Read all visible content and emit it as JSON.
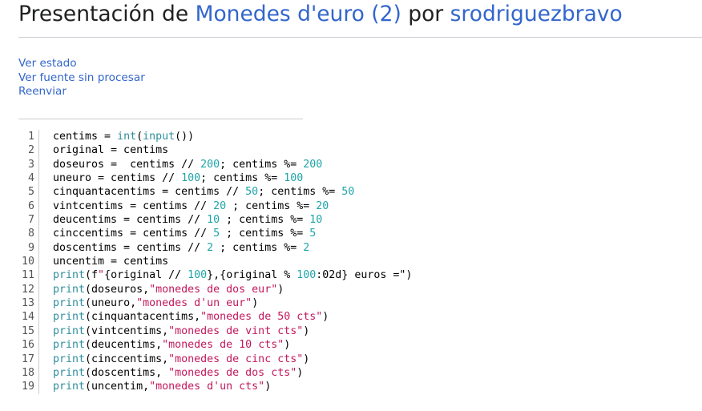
{
  "header": {
    "prefix": "Presentación de ",
    "problem_link": "Monedes d'euro (2)",
    "middle": " por ",
    "user_link": "srodriguezbravo"
  },
  "actions": [
    {
      "label": "Ver estado"
    },
    {
      "label": "Ver fuente sin procesar"
    },
    {
      "label": "Reenviar"
    }
  ],
  "code_lines": [
    [
      {
        "t": "centims = ",
        "c": "sym"
      },
      {
        "t": "int",
        "c": "kw"
      },
      {
        "t": "(",
        "c": "sym"
      },
      {
        "t": "input",
        "c": "kw"
      },
      {
        "t": "())",
        "c": "sym"
      }
    ],
    [
      {
        "t": "original = centims",
        "c": "sym"
      }
    ],
    [
      {
        "t": "doseuros =  centims // ",
        "c": "sym"
      },
      {
        "t": "200",
        "c": "num"
      },
      {
        "t": "; centims %= ",
        "c": "sym"
      },
      {
        "t": "200",
        "c": "num"
      }
    ],
    [
      {
        "t": "uneuro = centims // ",
        "c": "sym"
      },
      {
        "t": "100",
        "c": "num"
      },
      {
        "t": "; centims %= ",
        "c": "sym"
      },
      {
        "t": "100",
        "c": "num"
      }
    ],
    [
      {
        "t": "cinquantacentims = centims // ",
        "c": "sym"
      },
      {
        "t": "50",
        "c": "num"
      },
      {
        "t": "; centims %= ",
        "c": "sym"
      },
      {
        "t": "50",
        "c": "num"
      }
    ],
    [
      {
        "t": "vintcentims = centims // ",
        "c": "sym"
      },
      {
        "t": "20",
        "c": "num"
      },
      {
        "t": " ; centims %= ",
        "c": "sym"
      },
      {
        "t": "20",
        "c": "num"
      }
    ],
    [
      {
        "t": "deucentims = centims // ",
        "c": "sym"
      },
      {
        "t": "10",
        "c": "num"
      },
      {
        "t": " ; centims %= ",
        "c": "sym"
      },
      {
        "t": "10",
        "c": "num"
      }
    ],
    [
      {
        "t": "cinccentims = centims // ",
        "c": "sym"
      },
      {
        "t": "5",
        "c": "num"
      },
      {
        "t": " ; centims %= ",
        "c": "sym"
      },
      {
        "t": "5",
        "c": "num"
      }
    ],
    [
      {
        "t": "doscentims = centims // ",
        "c": "sym"
      },
      {
        "t": "2",
        "c": "num"
      },
      {
        "t": " ; centims %= ",
        "c": "sym"
      },
      {
        "t": "2",
        "c": "num"
      }
    ],
    [
      {
        "t": "uncentim = centims",
        "c": "sym"
      }
    ],
    [
      {
        "t": "print",
        "c": "kw"
      },
      {
        "t": "(f",
        "c": "sym"
      },
      {
        "t": "\"",
        "c": "str"
      },
      {
        "t": "{original // ",
        "c": "sym"
      },
      {
        "t": "100",
        "c": "num"
      },
      {
        "t": "},{original % ",
        "c": "sym"
      },
      {
        "t": "100",
        "c": "num"
      },
      {
        "t": ":02d} euros =\")",
        "c": "sym"
      }
    ],
    [
      {
        "t": "print",
        "c": "kw"
      },
      {
        "t": "(doseuros,",
        "c": "sym"
      },
      {
        "t": "\"monedes de dos eur\"",
        "c": "str"
      },
      {
        "t": ")",
        "c": "sym"
      }
    ],
    [
      {
        "t": "print",
        "c": "kw"
      },
      {
        "t": "(uneuro,",
        "c": "sym"
      },
      {
        "t": "\"monedes d'un eur\"",
        "c": "str"
      },
      {
        "t": ")",
        "c": "sym"
      }
    ],
    [
      {
        "t": "print",
        "c": "kw"
      },
      {
        "t": "(cinquantacentims,",
        "c": "sym"
      },
      {
        "t": "\"monedes de 50 cts\"",
        "c": "str"
      },
      {
        "t": ")",
        "c": "sym"
      }
    ],
    [
      {
        "t": "print",
        "c": "kw"
      },
      {
        "t": "(vintcentims,",
        "c": "sym"
      },
      {
        "t": "\"monedes de vint cts\"",
        "c": "str"
      },
      {
        "t": ")",
        "c": "sym"
      }
    ],
    [
      {
        "t": "print",
        "c": "kw"
      },
      {
        "t": "(deucentims,",
        "c": "sym"
      },
      {
        "t": "\"monedes de 10 cts\"",
        "c": "str"
      },
      {
        "t": ")",
        "c": "sym"
      }
    ],
    [
      {
        "t": "print",
        "c": "kw"
      },
      {
        "t": "(cinccentims,",
        "c": "sym"
      },
      {
        "t": "\"monedes de cinc cts\"",
        "c": "str"
      },
      {
        "t": ")",
        "c": "sym"
      }
    ],
    [
      {
        "t": "print",
        "c": "kw"
      },
      {
        "t": "(doscentims, ",
        "c": "sym"
      },
      {
        "t": "\"monedes de dos cts\"",
        "c": "str"
      },
      {
        "t": ")",
        "c": "sym"
      }
    ],
    [
      {
        "t": "print",
        "c": "kw"
      },
      {
        "t": "(uncentim,",
        "c": "sym"
      },
      {
        "t": "\"monedes d'un cts\"",
        "c": "str"
      },
      {
        "t": ")",
        "c": "sym"
      }
    ]
  ],
  "colors": {
    "link": "#3366cc",
    "keyword": "#2f8f9d",
    "number": "#1fa4a8",
    "string": "#c2185b"
  }
}
